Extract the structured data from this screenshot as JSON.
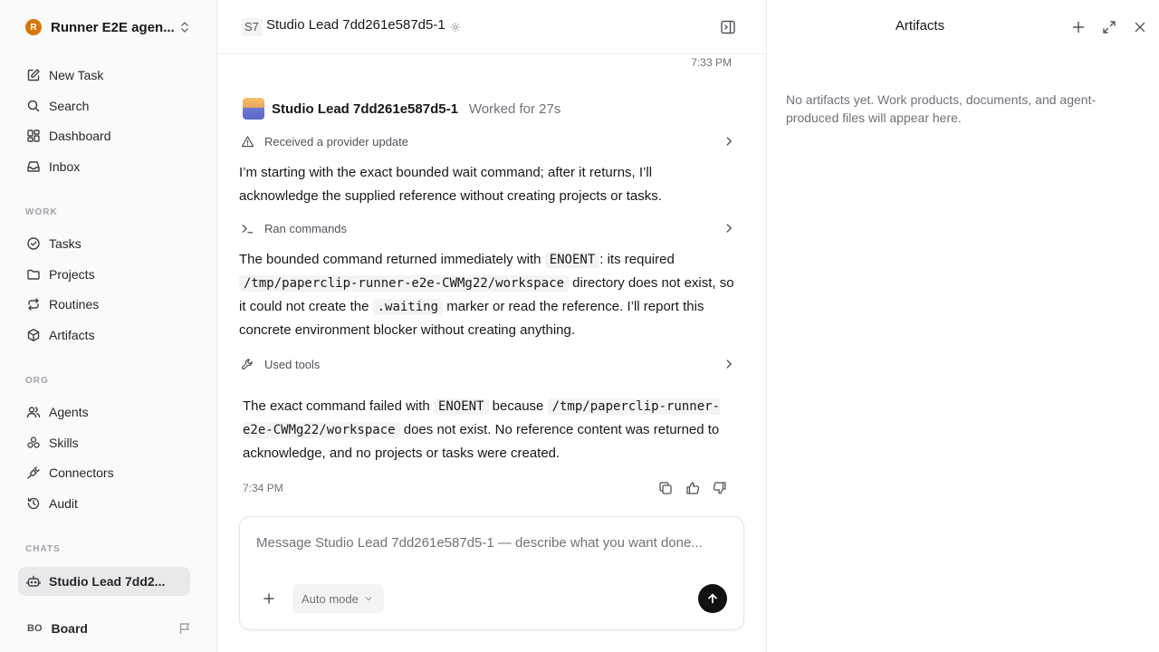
{
  "workspace": {
    "logo_letter": "R",
    "name": "Runner E2E agen..."
  },
  "nav": {
    "main": [
      {
        "label": "New Task",
        "icon": "edit-icon"
      },
      {
        "label": "Search",
        "icon": "search-icon"
      },
      {
        "label": "Dashboard",
        "icon": "grid-icon"
      },
      {
        "label": "Inbox",
        "icon": "inbox-icon"
      }
    ],
    "work_label": "WORK",
    "work": [
      {
        "label": "Tasks",
        "icon": "check-circle-icon"
      },
      {
        "label": "Projects",
        "icon": "folder-icon"
      },
      {
        "label": "Routines",
        "icon": "repeat-icon"
      },
      {
        "label": "Artifacts",
        "icon": "box-icon"
      }
    ],
    "org_label": "ORG",
    "org": [
      {
        "label": "Agents",
        "icon": "users-icon"
      },
      {
        "label": "Skills",
        "icon": "skills-icon"
      },
      {
        "label": "Connectors",
        "icon": "plug-icon"
      },
      {
        "label": "Audit",
        "icon": "history-icon"
      }
    ],
    "chats_label": "CHATS",
    "chats": [
      {
        "label": "Studio Lead 7dd2...",
        "icon": "bot-icon"
      }
    ]
  },
  "board": {
    "initials": "BO",
    "label": "Board"
  },
  "chat": {
    "badge": "S7",
    "title": "Studio Lead 7dd261e587d5-1",
    "time_top": "7:33 PM",
    "agent_name": "Studio Lead 7dd261e587d5-1",
    "worked": "Worked for 27s",
    "step1": "Received a provider update",
    "para1": "I’m starting with the exact bounded wait command; after it returns, I’ll acknowledge the supplied reference without creating projects or tasks.",
    "step2": "Ran commands",
    "para2": {
      "t1": "The bounded command returned immediately with ",
      "c1": "ENOENT",
      "t2": ": its required ",
      "c2": "/tmp/paperclip-runner-e2e-CWMg22/workspace",
      "t3": " directory does not exist, so it could not create the ",
      "c3": ".waiting",
      "t4": " marker or read the reference. I’ll report this concrete environment blocker without creating anything."
    },
    "step3": "Used tools",
    "para3": {
      "t1": "The exact command failed with ",
      "c1": "ENOENT",
      "t2": " because ",
      "c2": "/tmp/paperclip-runner-e2e-CWMg22/workspace",
      "t3": " does not exist. No reference content was returned to acknowledge, and no projects or tasks were created."
    },
    "time_bottom": "7:34 PM"
  },
  "composer": {
    "placeholder": "Message Studio Lead 7dd261e587d5-1 — describe what you want done...",
    "mode": "Auto mode"
  },
  "artifacts": {
    "title": "Artifacts",
    "empty": "No artifacts yet. Work products, documents, and agent-produced files will appear here."
  }
}
